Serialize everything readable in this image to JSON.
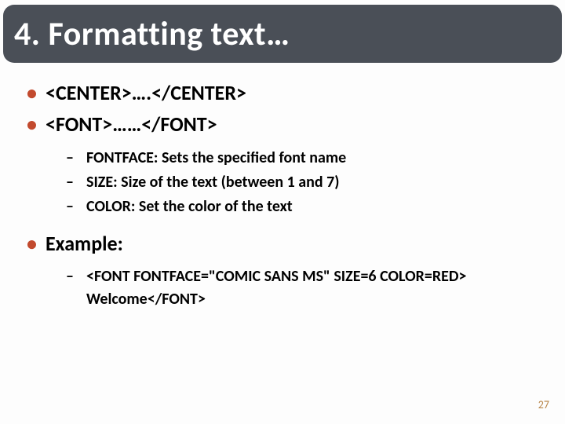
{
  "title": "4. Formatting text…",
  "bullets": {
    "b1": "<CENTER>….</CENTER>",
    "b2": "<FONT>……</FONT>",
    "b2_sub": {
      "s1": "FONTFACE: Sets the specified font name",
      "s2": "SIZE: Size of the text (between 1 and 7)",
      "s3": "COLOR: Set the color of the text"
    },
    "b3": "Example:",
    "b3_sub": {
      "s1": "<FONT FONTFACE=\"COMIC SANS MS\" SIZE=6 COLOR=RED> Welcome</FONT>"
    }
  },
  "page_number": "27"
}
